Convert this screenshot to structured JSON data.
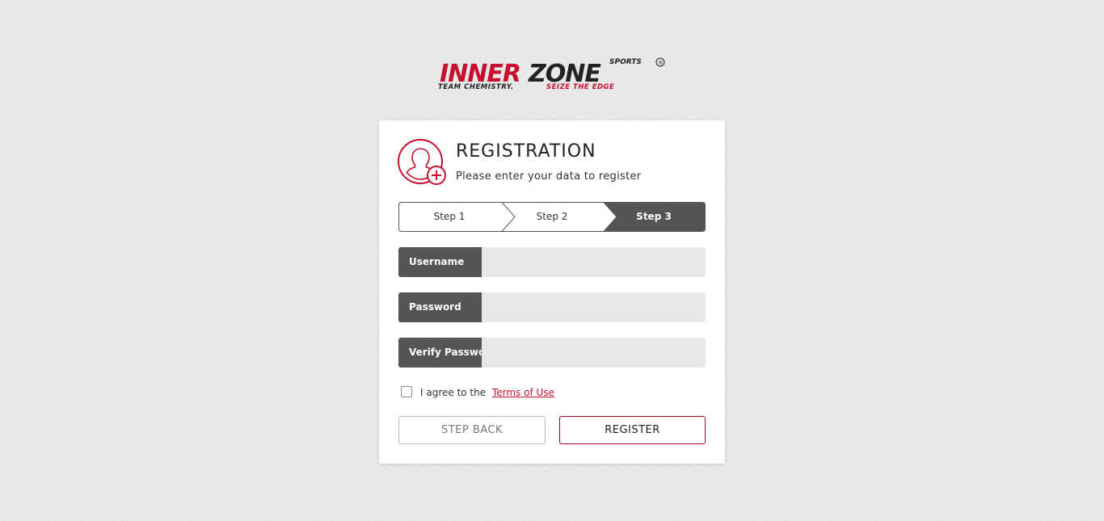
{
  "brand": {
    "name_part1": "INNER",
    "name_part2": "ZONE",
    "badge": "SPORTS",
    "tagline_part1": "TEAM CHEMISTRY.",
    "tagline_part2": "SEIZE THE EDGE",
    "colors": {
      "red": "#c8102e",
      "dark": "#222222"
    }
  },
  "header": {
    "icon": "user-add-icon",
    "title": "REGISTRATION",
    "subtitle": "Please enter your data to register"
  },
  "steps": [
    {
      "label": "Step 1",
      "active": false
    },
    {
      "label": "Step 2",
      "active": false
    },
    {
      "label": "Step 3",
      "active": true
    }
  ],
  "fields": {
    "username": {
      "label": "Username",
      "value": ""
    },
    "password": {
      "label": "Password",
      "value": ""
    },
    "verify_password": {
      "label": "Verify Password",
      "value": ""
    }
  },
  "agreement": {
    "text": "I agree to the",
    "link": "Terms of Use",
    "checked": false
  },
  "buttons": {
    "back": "STEP BACK",
    "register": "REGISTER"
  },
  "colors": {
    "accent": "#c8102e",
    "label_bg": "#555555",
    "input_bg": "#e8e8e8",
    "page_bg": "#e6e6e6"
  }
}
